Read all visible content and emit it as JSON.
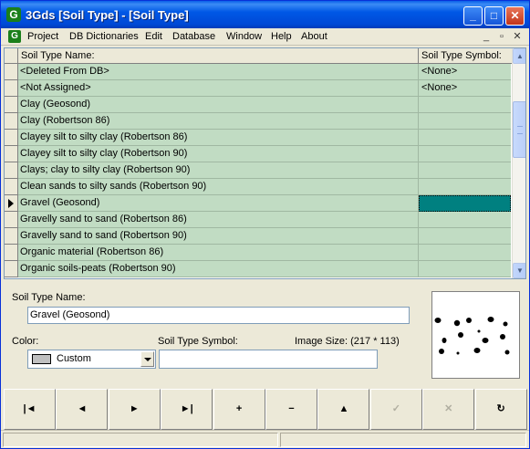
{
  "window": {
    "title": "3Gds [Soil Type] - [Soil Type]",
    "app_icon_letter": "G",
    "controls": {
      "minimize": "_",
      "maximize": "□",
      "close": "✕"
    }
  },
  "menu": {
    "items": [
      "Project",
      "DB Dictionaries",
      "Edit",
      "Database",
      "Window",
      "Help",
      "About"
    ],
    "mdi_controls": [
      "_",
      "▫",
      "✕"
    ]
  },
  "grid": {
    "columns": [
      "Soil Type Name:",
      "Soil Type Symbol:"
    ],
    "rows": [
      {
        "name": "<Deleted From DB>",
        "symbol": "<None>"
      },
      {
        "name": "<Not Assigned>",
        "symbol": "<None>"
      },
      {
        "name": "Clay (Geosond)",
        "symbol": ""
      },
      {
        "name": "Clay (Robertson 86)",
        "symbol": ""
      },
      {
        "name": "Clayey silt to silty clay (Robertson 86)",
        "symbol": ""
      },
      {
        "name": "Clayey silt to silty clay (Robertson 90)",
        "symbol": ""
      },
      {
        "name": "Clays; clay to silty clay (Robertson 90)",
        "symbol": ""
      },
      {
        "name": "Clean sands to silty sands (Robertson 90)",
        "symbol": ""
      },
      {
        "name": "Gravel (Geosond)",
        "symbol": "",
        "selected": true
      },
      {
        "name": "Gravelly sand to sand (Robertson 86)",
        "symbol": ""
      },
      {
        "name": "Gravelly sand to sand (Robertson 90)",
        "symbol": ""
      },
      {
        "name": "Organic material (Robertson 86)",
        "symbol": ""
      },
      {
        "name": "Organic soils-peats (Robertson 90)",
        "symbol": ""
      }
    ],
    "row_color": "#c1dcc3",
    "selected_symbol_color": "#008080"
  },
  "form": {
    "name_label": "Soil Type Name:",
    "name_value": "Gravel (Geosond)",
    "color_label": "Color:",
    "color_value": "Custom",
    "symbol_label": "Soil Type Symbol:",
    "symbol_value": "",
    "image_size": "Image Size: (217 * 113)"
  },
  "navigator": {
    "buttons": [
      {
        "name": "first-record-button",
        "glyph": "|◄",
        "enabled": true
      },
      {
        "name": "prior-record-button",
        "glyph": "◄",
        "enabled": true
      },
      {
        "name": "next-record-button",
        "glyph": "►",
        "enabled": true
      },
      {
        "name": "last-record-button",
        "glyph": "►|",
        "enabled": true
      },
      {
        "name": "insert-record-button",
        "glyph": "+",
        "enabled": true
      },
      {
        "name": "delete-record-button",
        "glyph": "−",
        "enabled": true
      },
      {
        "name": "edit-record-button",
        "glyph": "▲",
        "enabled": true
      },
      {
        "name": "post-edit-button",
        "glyph": "✓",
        "enabled": false
      },
      {
        "name": "cancel-edit-button",
        "glyph": "✕",
        "enabled": false
      },
      {
        "name": "refresh-button",
        "glyph": "↻",
        "enabled": true
      }
    ]
  }
}
